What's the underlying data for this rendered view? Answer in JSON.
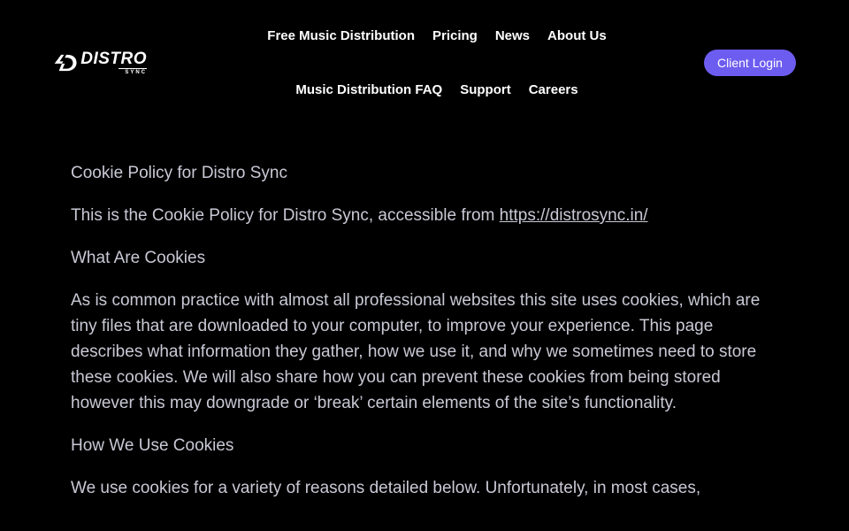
{
  "header": {
    "logo": {
      "word": "DISTRO",
      "sub": "SYNC"
    },
    "nav_row1": [
      {
        "label": "Free Music Distribution"
      },
      {
        "label": "Pricing"
      },
      {
        "label": "News"
      },
      {
        "label": "About Us"
      }
    ],
    "nav_row2": [
      {
        "label": "Music Distribution FAQ"
      },
      {
        "label": "Support"
      },
      {
        "label": "Careers"
      }
    ],
    "login_label": "Client Login"
  },
  "content": {
    "title": "Cookie Policy for Distro Sync",
    "intro_prefix": "This is the Cookie Policy for Distro Sync, accessible from ",
    "intro_link": "https://distrosync.in/",
    "heading_what": "What Are Cookies",
    "para_what": "As is common practice with almost all professional websites this site uses cookies, which are tiny files that are downloaded to your computer, to improve your experience. This page describes what information they gather, how we use it, and why we sometimes need to store these cookies. We will also share how you can prevent these cookies from being stored however this may downgrade or ‘break’ certain elements of the site’s functionality.",
    "heading_how": "How We Use Cookies",
    "para_how": "We use cookies for a variety of reasons detailed below. Unfortunately, in most cases,"
  },
  "colors": {
    "background": "#000000",
    "accent": "#6d5cf0",
    "body_text": "#c9c9d6",
    "nav_text": "#ffffff"
  }
}
